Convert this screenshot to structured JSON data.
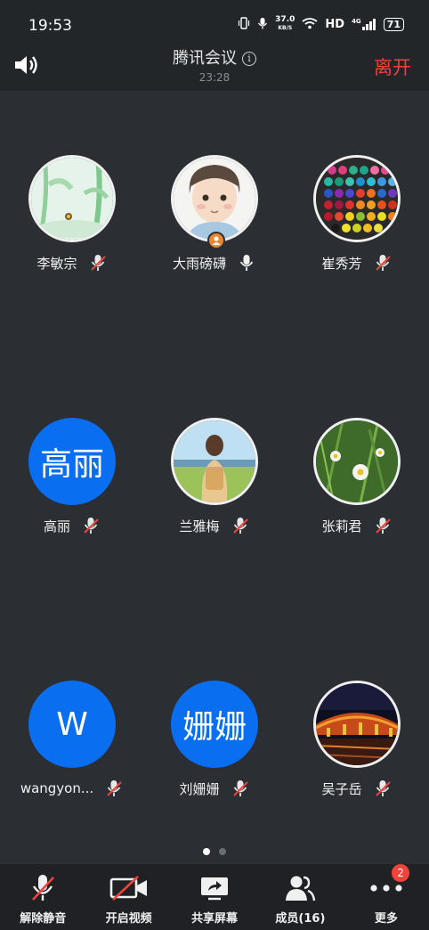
{
  "status_bar": {
    "time": "19:53",
    "net_speed_value": "37.0",
    "net_speed_unit": "KB/S",
    "hd_label": "HD",
    "signal_label": "4G",
    "battery": "71"
  },
  "header": {
    "title": "腾讯会议",
    "duration": "23:28",
    "leave_label": "离开"
  },
  "participants": [
    {
      "name": "李敏宗",
      "avatar_type": "image",
      "muted": true
    },
    {
      "name": "大雨磅礴",
      "avatar_type": "image",
      "muted": false,
      "host": true
    },
    {
      "name": "崔秀芳",
      "avatar_type": "image",
      "muted": true
    },
    {
      "name": "高丽",
      "avatar_type": "text",
      "avatar_text": "高丽",
      "muted": true
    },
    {
      "name": "兰雅梅",
      "avatar_type": "image",
      "muted": true
    },
    {
      "name": "张莉君",
      "avatar_type": "image",
      "muted": true
    },
    {
      "name": "wangyon...",
      "avatar_type": "text",
      "avatar_text": "W",
      "muted": true
    },
    {
      "name": "刘姗姗",
      "avatar_type": "text",
      "avatar_text": "姗姗",
      "muted": true
    },
    {
      "name": "吴子岳",
      "avatar_type": "image",
      "muted": true
    }
  ],
  "pager": {
    "pages": 2,
    "current": 1
  },
  "toolbar": {
    "unmute_label": "解除静音",
    "video_label": "开启视频",
    "share_label": "共享屏幕",
    "members_label": "成员(16)",
    "more_label": "更多",
    "more_badge": "2"
  },
  "colors": {
    "accent_blue": "#0a6ef0",
    "leave_red": "#f0433a",
    "background": "#2b2e33"
  }
}
